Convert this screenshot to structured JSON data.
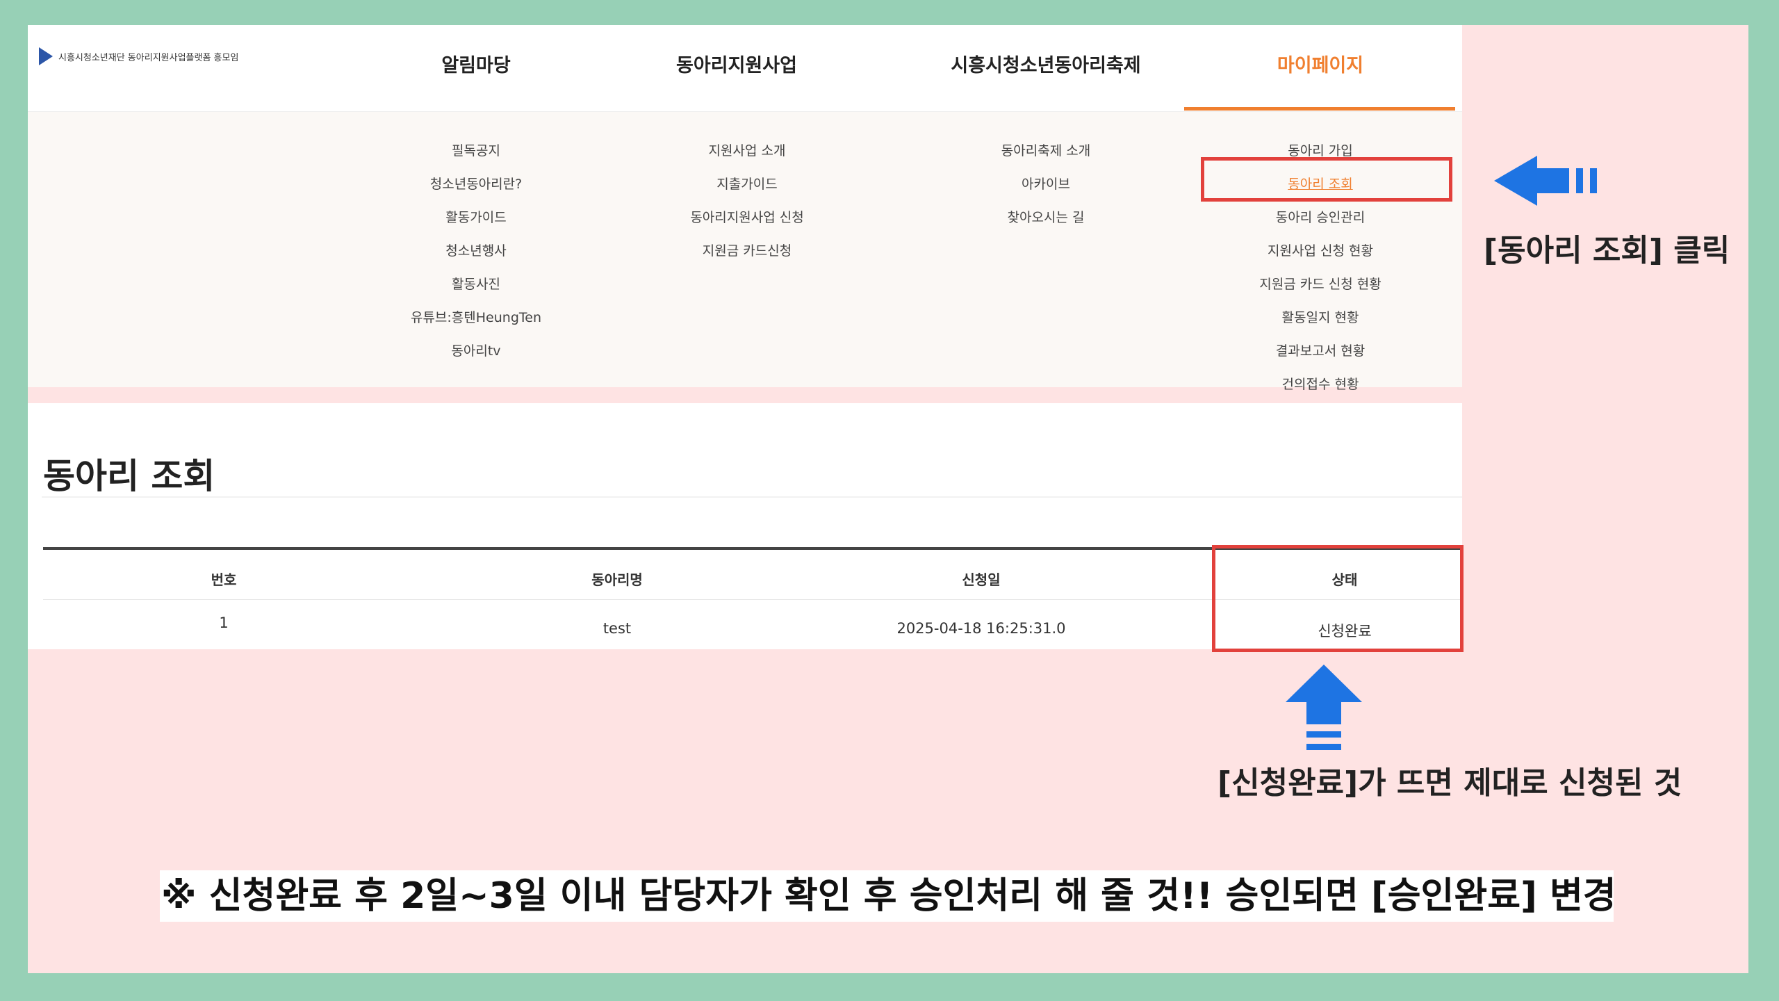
{
  "site": {
    "logo_text": "시흥시청소년재단 동아리지원사업플랫폼 흥모임"
  },
  "nav": [
    {
      "label": "알림마당"
    },
    {
      "label": "동아리지원사업"
    },
    {
      "label": "시흥시청소년동아리축제"
    },
    {
      "label": "마이페이지",
      "active": true
    }
  ],
  "menus": {
    "col1": [
      "필독공지",
      "청소년동아리란?",
      "활동가이드",
      "청소년행사",
      "활동사진",
      "유튜브:흥텐HeungTen",
      "동아리tv"
    ],
    "col2": [
      "지원사업 소개",
      "지출가이드",
      "동아리지원사업 신청",
      "지원금 카드신청"
    ],
    "col3": [
      "동아리축제 소개",
      "아카이브",
      "찾아오시는 길"
    ],
    "col4": [
      "동아리 가입",
      "동아리 조회",
      "동아리 승인관리",
      "지원사업 신청 현황",
      "지원금 카드 신청 현황",
      "활동일지 현황",
      "결과보고서 현황",
      "건의접수 현황"
    ]
  },
  "page": {
    "title": "동아리 조회"
  },
  "table": {
    "headers": [
      "번호",
      "동아리명",
      "신청일",
      "상태"
    ],
    "rows": [
      [
        "1",
        "test",
        "2025-04-18 16:25:31.0",
        "신청완료"
      ]
    ]
  },
  "annotations": {
    "click_label": "[동아리 조회] 클릭",
    "status_label": "[신청완료]가 뜨면 제대로 신청된 것",
    "note": "※ 신청완료 후 2일~3일 이내 담당자가 확인 후 승인처리 해 줄 것!! 승인되면 [승인완료] 변경"
  },
  "colors": {
    "frame": "#97d0b6",
    "slide_bg": "#fee3e3",
    "accent": "#f07f2f",
    "highlight": "#e2413c",
    "arrow": "#1e74e3"
  }
}
